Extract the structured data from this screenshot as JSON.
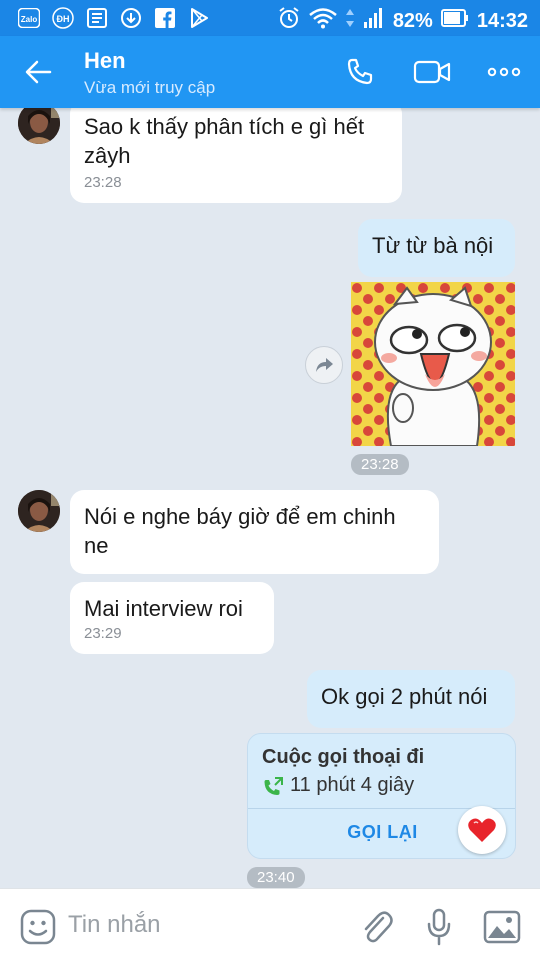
{
  "statusbar": {
    "icons": [
      "zalo-icon",
      "dh-icon",
      "news-icon",
      "download-icon",
      "facebook-icon",
      "play-store-icon"
    ],
    "zalo_label": "Zalo",
    "dh_label": "ĐH",
    "battery": "82%",
    "time": "14:32"
  },
  "header": {
    "name": "Hen",
    "status": "Vừa mới truy cập"
  },
  "messages": [
    {
      "dir": "in",
      "text_line1": "Sao k thấy phân tích e gì hết",
      "text_line2": "zâyh",
      "time": "23:28"
    },
    {
      "dir": "out",
      "text": "Từ từ bà nội"
    },
    {
      "sticker_time": "23:28"
    },
    {
      "dir": "in",
      "text_line1": "Nói e nghe báy giờ để em chinh",
      "text_line2": "ne"
    },
    {
      "dir": "in",
      "text": "Mai interview roi",
      "time": "23:29"
    },
    {
      "dir": "out",
      "text": "Ok gọi 2 phút nói"
    }
  ],
  "call": {
    "title": "Cuộc gọi thoại đi",
    "duration": "11 phút 4 giây",
    "action": "GỌI LẠI",
    "time": "23:40"
  },
  "composer": {
    "placeholder": "Tin nhắn"
  },
  "colors": {
    "header": "#2196f3",
    "statusbar": "#1b86e6",
    "chat_bg": "#e1e8f0",
    "outgoing_bubble": "#d6ecfb",
    "incoming_bubble": "#ffffff",
    "accent": "#1e88e5"
  }
}
